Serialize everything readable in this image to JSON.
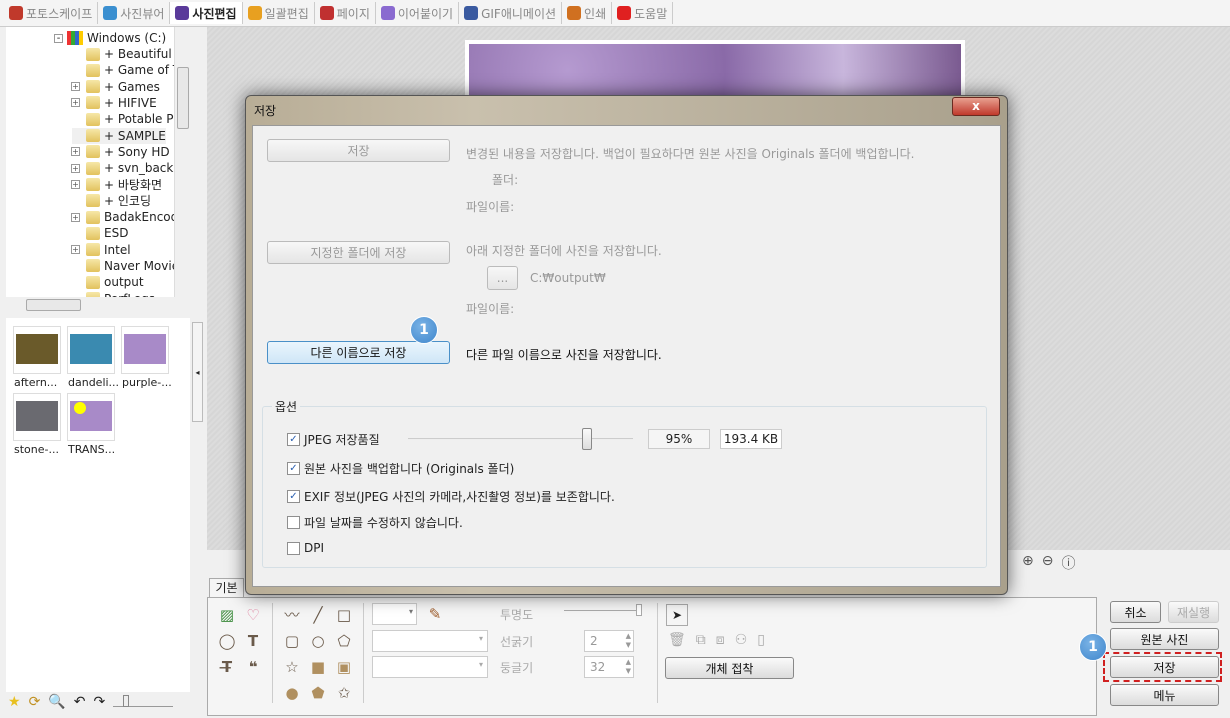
{
  "tabs": [
    {
      "label": "포토스케이프",
      "color": "#c0392b"
    },
    {
      "label": "사진뷰어",
      "color": "#3a8fd0"
    },
    {
      "label": "사진편집",
      "color": "#5a3a9a",
      "active": true
    },
    {
      "label": "일괄편집",
      "color": "#e8a020"
    },
    {
      "label": "페이지",
      "color": "#c03030"
    },
    {
      "label": "이어붙이기",
      "color": "#8a6ad0"
    },
    {
      "label": "GIF애니메이션",
      "color": "#3a5aa0"
    },
    {
      "label": "인쇄",
      "color": "#d07020"
    },
    {
      "label": "도움말",
      "color": "#e02020"
    }
  ],
  "tree": {
    "root": "Windows (C:)",
    "items": [
      "+ Beautiful",
      "+ Game of T",
      "+ Games",
      "+ HIFIVE",
      "+ Potable P",
      "+ SAMPLE",
      "+ Sony HD",
      "+ svn_backu",
      "+ 바탕화면",
      "+ 인코딩",
      "BadakEncod",
      "ESD",
      "Intel",
      "Naver Movie",
      "output",
      "PerfLogs"
    ]
  },
  "thumbnails": [
    {
      "label": "aftern...",
      "color": "#6a5a2a"
    },
    {
      "label": "dandeli...",
      "color": "#3a8ab0"
    },
    {
      "label": "purple-...",
      "color": "#a88ac8"
    },
    {
      "label": "stone-...",
      "color": "#6a6a70"
    },
    {
      "label": "TRANS...",
      "color": "#a88ac8"
    }
  ],
  "dialog": {
    "title": "저장",
    "close": "x",
    "save": {
      "label": "저장",
      "desc": "변경된 내용을 저장합니다. 백업이 필요하다면 원본 사진을 Originals 폴더에 백업합니다.",
      "folder_label": "폴더:",
      "filename_label": "파일이름:"
    },
    "save_folder": {
      "label": "지정한 폴더에 저장",
      "desc": "아래 지정한 폴더에 사진을 저장합니다.",
      "browse": "...",
      "path": "C:₩output₩",
      "filename_label": "파일이름:"
    },
    "save_as": {
      "label": "다른 이름으로 저장",
      "desc": "다른 파일 이름으로 사진을 저장합니다.",
      "badge": "1"
    },
    "options": {
      "legend": "옵션",
      "jpeg_quality_label": "JPEG 저장품질",
      "jpeg_quality_percent": 95,
      "quality_text": "95%",
      "size_text": "193.4 KB",
      "checks": [
        {
          "label": "JPEG 저장품질",
          "checked": true
        },
        {
          "label": "원본 사진을 백업합니다 (Originals 폴더)",
          "checked": true
        },
        {
          "label": "EXIF 정보(JPEG 사진의 카메라,사진촬영 정보)를 보존합니다.",
          "checked": true
        },
        {
          "label": "파일 날짜를 수정하지 않습니다.",
          "checked": false
        },
        {
          "label": "DPI",
          "checked": false
        }
      ]
    }
  },
  "bottom": {
    "tab": "기본",
    "opacity_label": "투명도",
    "line_width_label": "선굵기",
    "line_width": "2",
    "roundness_label": "둥글기",
    "roundness": "32",
    "attach_label": "개체 접착"
  },
  "right": {
    "undo": "취소",
    "redo": "재실행",
    "original": "원본 사진",
    "save": "저장",
    "menu": "메뉴",
    "badge": "1"
  }
}
